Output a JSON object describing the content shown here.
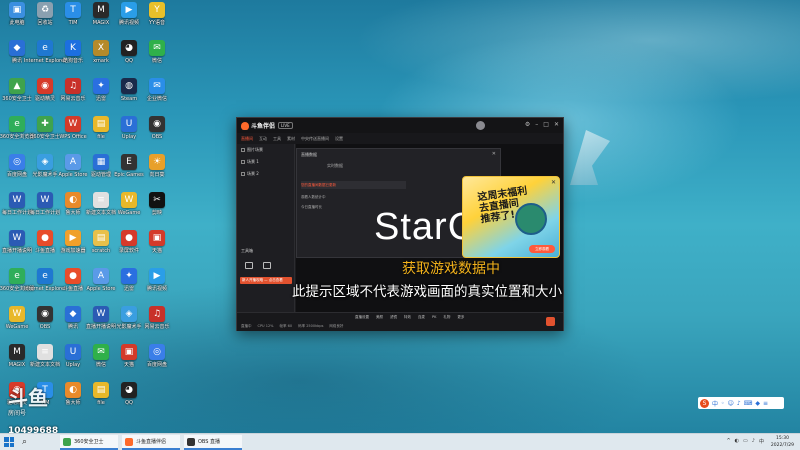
{
  "desktop": {
    "icons": [
      {
        "label": "此电脑",
        "glyph": "▣",
        "color": "#3b8fe0"
      },
      {
        "label": "腾讯",
        "glyph": "◆",
        "color": "#2a6fd6"
      },
      {
        "label": "360安全卫士",
        "glyph": "▲",
        "color": "#3fa34d"
      },
      {
        "label": "360安全浏览器",
        "glyph": "e",
        "color": "#2fae5a"
      },
      {
        "label": "百度网盘",
        "glyph": "◎",
        "color": "#3a7ee8"
      },
      {
        "label": "每日工作计划",
        "glyph": "W",
        "color": "#2b5bb4"
      },
      {
        "label": "直播开播说明",
        "glyph": "W",
        "color": "#2b5bb4"
      },
      {
        "label": "回收站",
        "glyph": "♻",
        "color": "#8aa0b0"
      },
      {
        "label": "Internet Explorer",
        "glyph": "e",
        "color": "#1f78d1"
      },
      {
        "label": "驱动精灵",
        "glyph": "◉",
        "color": "#d63a2a"
      },
      {
        "label": "360安全卫士",
        "glyph": "✚",
        "color": "#3fa34d"
      },
      {
        "label": "光影魔术手",
        "glyph": "◈",
        "color": "#3a9ee0"
      },
      {
        "label": "每日工作计划",
        "glyph": "W",
        "color": "#2b5bb4"
      },
      {
        "label": "斗鱼直播",
        "glyph": "●",
        "color": "#e84c2a"
      },
      {
        "label": "TIM",
        "glyph": "T",
        "color": "#2a8ee8"
      },
      {
        "label": "酷狗音乐",
        "glyph": "K",
        "color": "#1c6fe0"
      },
      {
        "label": "网易云音乐",
        "glyph": "♫",
        "color": "#c8312a"
      },
      {
        "label": "WPS Office",
        "glyph": "W",
        "color": "#d43a2a"
      },
      {
        "label": "Apple Store",
        "glyph": "A",
        "color": "#5a9ae8"
      },
      {
        "label": "鲁大师",
        "glyph": "◐",
        "color": "#e88a2a"
      },
      {
        "label": "游戏加速器",
        "glyph": "▶",
        "color": "#f0a02a"
      },
      {
        "label": "MAGIX",
        "glyph": "M",
        "color": "#2a2a2a"
      },
      {
        "label": "xmark",
        "glyph": "X",
        "color": "#b48a2a"
      },
      {
        "label": "迅雷",
        "glyph": "✦",
        "color": "#2a6fe0"
      },
      {
        "label": "file",
        "glyph": "▤",
        "color": "#e8b82a"
      },
      {
        "label": "驱动管理",
        "glyph": "▦",
        "color": "#2a6fd6"
      },
      {
        "label": "新建文本文档",
        "glyph": "≡",
        "color": "#e0e0e0"
      },
      {
        "label": "scratch",
        "glyph": "▤",
        "color": "#e8c04a"
      },
      {
        "label": "腾讯视频",
        "glyph": "▶",
        "color": "#2a9ee8"
      },
      {
        "label": "QQ",
        "glyph": "◕",
        "color": "#222"
      },
      {
        "label": "Steam",
        "glyph": "◍",
        "color": "#1a2a4a"
      },
      {
        "label": "Uplay",
        "glyph": "U",
        "color": "#2a6fd6"
      },
      {
        "label": "Epic Games",
        "glyph": "E",
        "color": "#333"
      },
      {
        "label": "WeGame",
        "glyph": "W",
        "color": "#e8b82a"
      },
      {
        "label": "录屏软件",
        "glyph": "●",
        "color": "#d63a2a"
      },
      {
        "label": "YY语音",
        "glyph": "Y",
        "color": "#e8c02a"
      },
      {
        "label": "微信",
        "glyph": "✉",
        "color": "#2fb04a"
      },
      {
        "label": "企业微信",
        "glyph": "✉",
        "color": "#2a8ee8"
      },
      {
        "label": "OBS",
        "glyph": "◉",
        "color": "#333"
      },
      {
        "label": "向日葵",
        "glyph": "☀",
        "color": "#e8a02a"
      },
      {
        "label": "剪映",
        "glyph": "✂",
        "color": "#111"
      },
      {
        "label": "天猫",
        "glyph": "▣",
        "color": "#d43a2a"
      }
    ]
  },
  "app": {
    "title": "斗鱼伴侣",
    "badge": "LIVE",
    "tabs": [
      "直播间",
      "互动",
      "工具",
      "素材",
      "中央传送直播间",
      "设置"
    ],
    "scenes": [
      "图片场景",
      "场景 1",
      "场景 2"
    ],
    "tools_title": "工具箱",
    "tip_bar": "新人开播攻略 — 点击查看",
    "dialog": {
      "header": "直播数据",
      "subtitle": "实时数据",
      "row1": "您的直播间数据已更新",
      "row2": "观看人数统计中",
      "row3": "今日直播时长"
    },
    "preview_logo": "StarC",
    "get_data_text": "获取游戏数据中",
    "ad": {
      "headline": "这周末福利\n去直播间\n推荐了!",
      "button": "立即观看"
    },
    "hint": "此提示区域不代表游戏画面的真实位置和大小",
    "bottom_tabs": [
      "直播设置",
      "美颜",
      "滤镜",
      "特效",
      "连麦",
      "PK",
      "礼物",
      "更多"
    ],
    "status": [
      "直播中",
      "CPU 12%",
      "帧率 60",
      "码率 2500kbps",
      "网络良好"
    ]
  },
  "overlay": {
    "logo_mark": "斗鱼",
    "logo_caption": "房间号",
    "room_number": "10499688"
  },
  "taskbar": {
    "search_glyph": "⌕",
    "windows": [
      {
        "label": "360安全卫士",
        "color": "#3fa34d"
      },
      {
        "label": "斗鱼直播伴侣",
        "color": "#ff6a2a"
      },
      {
        "label": "OBS 直播",
        "color": "#333333"
      }
    ],
    "tray": [
      "^",
      "◐",
      "▭",
      "♪",
      "中"
    ],
    "time": "15:30",
    "date": "2022/7/29"
  }
}
